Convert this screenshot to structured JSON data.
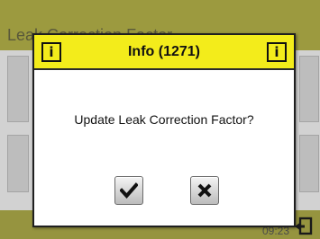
{
  "background": {
    "title": "Leak Correction Factor",
    "time": "09:23",
    "exit_icon": "exit-icon"
  },
  "dialog": {
    "title": "Info (1271)",
    "header_icon_glyph": "i",
    "header_icon": "info-icon",
    "message": "Update Leak Correction Factor?",
    "confirm_icon": "checkmark-icon",
    "cancel_icon": "x-icon"
  },
  "colors": {
    "dialog_header": "#f3ec1b",
    "background_header": "#9c9a3f",
    "overlay_background": "#d2d2d2"
  }
}
